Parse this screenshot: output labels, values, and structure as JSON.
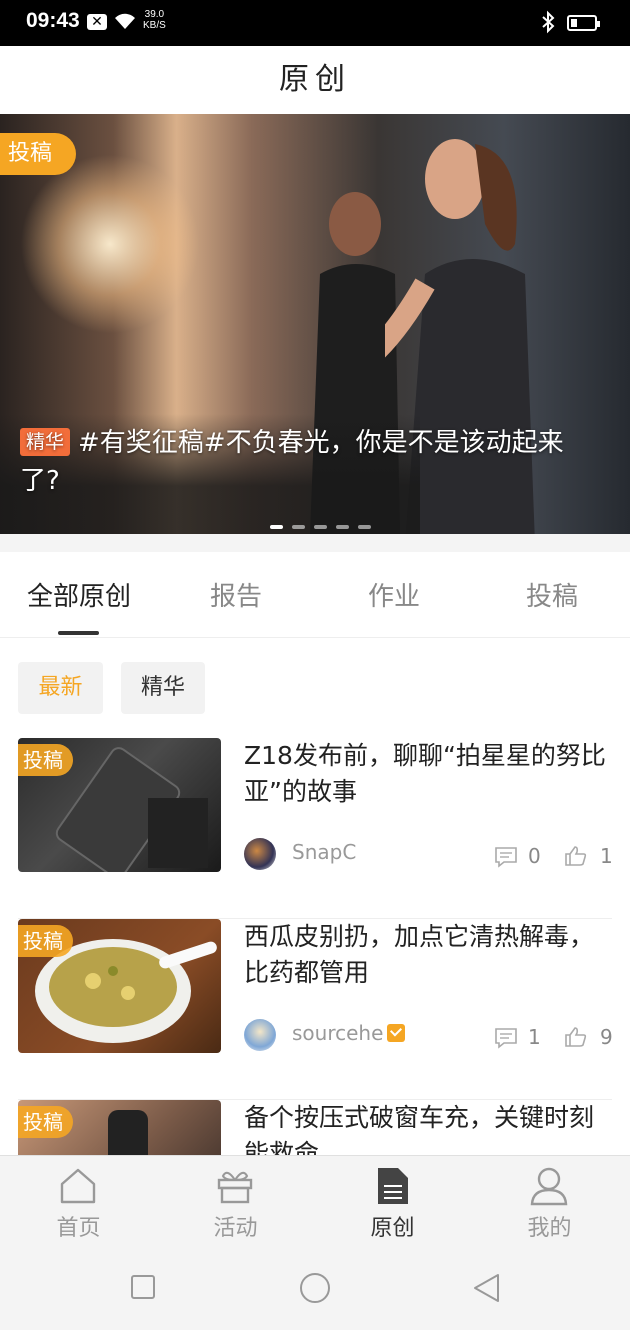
{
  "status_bar": {
    "time": "09:43",
    "speed_value": "39.0",
    "speed_unit": "KB/S"
  },
  "header": {
    "title": "原创"
  },
  "banner": {
    "tag": "投稿",
    "badge": "精华",
    "caption": "#有奖征稿#不负春光，你是不是该动起来了?",
    "dots_total": 5,
    "active_dot": 1
  },
  "tabs": [
    {
      "label": "全部原创",
      "active": true
    },
    {
      "label": "报告",
      "active": false
    },
    {
      "label": "作业",
      "active": false
    },
    {
      "label": "投稿",
      "active": false
    }
  ],
  "filters": [
    {
      "label": "最新",
      "active": true
    },
    {
      "label": "精华",
      "active": false
    }
  ],
  "articles": [
    {
      "tag": "投稿",
      "title": "Z18发布前，聊聊“拍星星的努比亚”的故事",
      "author": "SnapC",
      "verified": false,
      "comments": "0",
      "likes": "1"
    },
    {
      "tag": "投稿",
      "title": "西瓜皮别扔，加点它清热解毒，比药都管用",
      "author": "sourcehe",
      "verified": true,
      "comments": "1",
      "likes": "9"
    },
    {
      "tag": "投稿",
      "title": "备个按压式破窗车充，关键时刻能救命",
      "author": "",
      "verified": false,
      "comments": "",
      "likes": ""
    }
  ],
  "bottom_nav": [
    {
      "label": "首页",
      "icon": "home-icon",
      "active": false
    },
    {
      "label": "活动",
      "icon": "gift-icon",
      "active": false
    },
    {
      "label": "原创",
      "icon": "document-icon",
      "active": true
    },
    {
      "label": "我的",
      "icon": "user-icon",
      "active": false
    }
  ],
  "colors": {
    "accent": "#f5a623",
    "badge": "#f26d3a",
    "text": "#222222",
    "muted": "#999999"
  }
}
